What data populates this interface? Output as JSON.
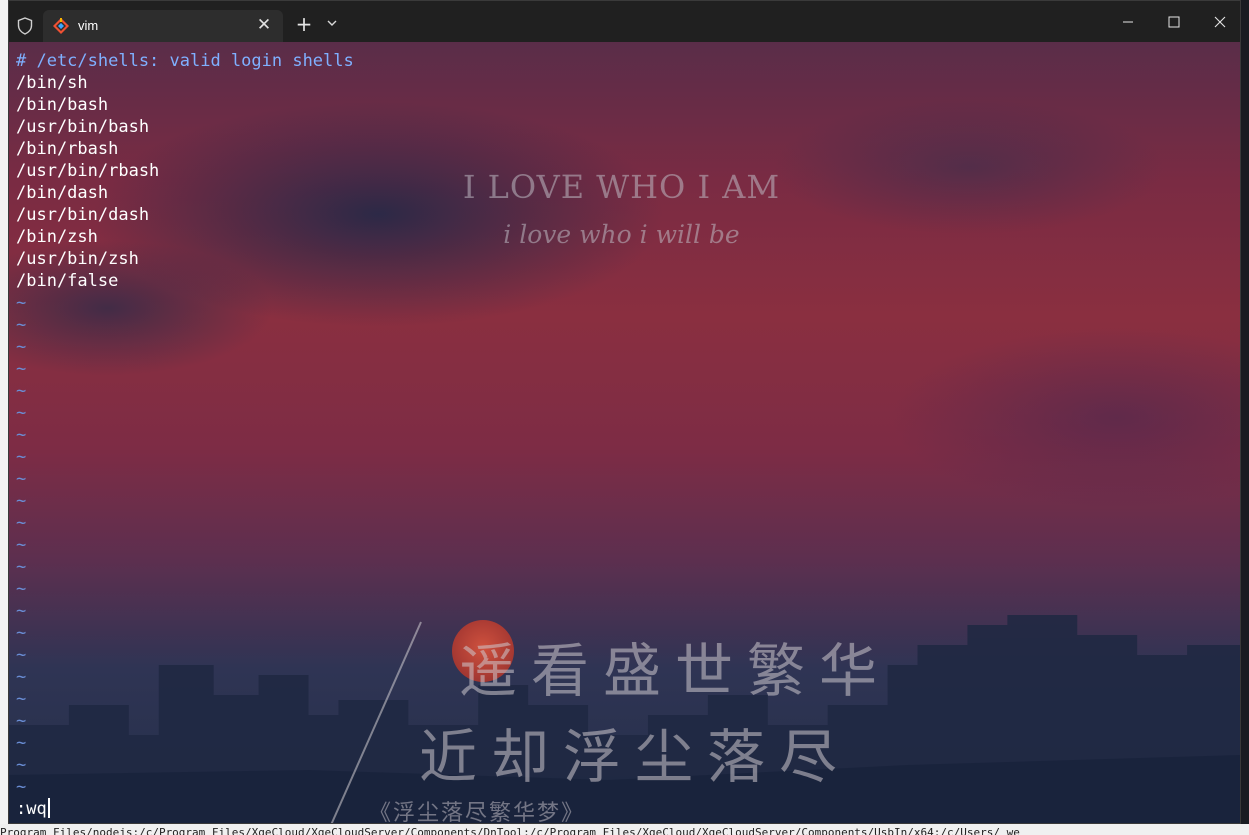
{
  "tab": {
    "title": "vim",
    "close_glyph": "✕"
  },
  "titlebar": {
    "new_tab_glyph": "+"
  },
  "editor": {
    "comment_line": "# /etc/shells: valid login shells",
    "lines": [
      "/bin/sh",
      "/bin/bash",
      "/usr/bin/bash",
      "/bin/rbash",
      "/usr/bin/rbash",
      "/bin/dash",
      "/usr/bin/dash",
      "/bin/zsh",
      "/usr/bin/zsh",
      "/bin/false"
    ],
    "tilde": "~",
    "tilde_count": 23,
    "command": ":wq"
  },
  "wallpaper": {
    "title": "I LOVE WHO I AM",
    "subtitle": "i love who i will be",
    "poem_line1": "遥看盛世繁华",
    "poem_line2": "近却浮尘落尽",
    "poem_source": "《浮尘落尽繁华梦》"
  },
  "background_path": "Program Files/nodejs;/c/Program Files/XgeCloud/XgeCloudServer/Components/DnTool;/c/Program Files/XgeCloud/XgeCloudServer/Components/UsbIn/x64;/c/Users/  we",
  "colors": {
    "comment": "#7fb0ff",
    "tilde": "#6a8ed6",
    "text": "#ffffff"
  }
}
